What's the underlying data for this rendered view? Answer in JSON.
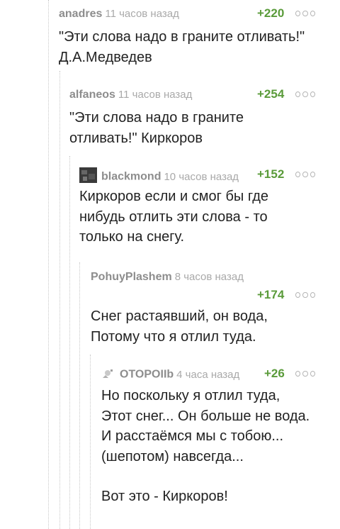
{
  "comments": [
    {
      "author": "anadres",
      "time": "11 часов назад",
      "rating": "+220",
      "lines": [
        "\"Эти слова надо в граните отливать!\"",
        "Д.А.Медведев"
      ]
    },
    {
      "author": "alfaneos",
      "time": "11 часов назад",
      "rating": "+254",
      "lines": [
        "\"Эти слова надо в граните",
        "отливать!\" Киркоров"
      ]
    },
    {
      "author": "blackmond",
      "time": "10 часов назад",
      "rating": "+152",
      "avatar": "user-avatar-icon",
      "lines": [
        "Киркоров если и смог бы где",
        "нибудь отлить эти слова - то",
        "только на снегу."
      ]
    },
    {
      "author": "PohuyPlashem",
      "time": "8 часов назад",
      "rating": "+174",
      "lines": [
        "Снег растаявший, он вода,",
        "Потому что я отлил туда."
      ]
    },
    {
      "author": "OTOPOIIb",
      "time": "4 часа назад",
      "rating": "+26",
      "avatar": "default-avatar-icon",
      "lines": [
        "Но поскольку я отлил туда,",
        "Этот снег... Он больше не вода.",
        "И расстаёмся мы с тобою...",
        "(шепотом) навсегда...",
        "",
        "Вот это - Киркоров!"
      ]
    }
  ],
  "menu_icon": "more-dots-icon",
  "colors": {
    "rating": "#5a9b3a",
    "author": "#8d8d8d",
    "time": "#a9a9a9"
  }
}
